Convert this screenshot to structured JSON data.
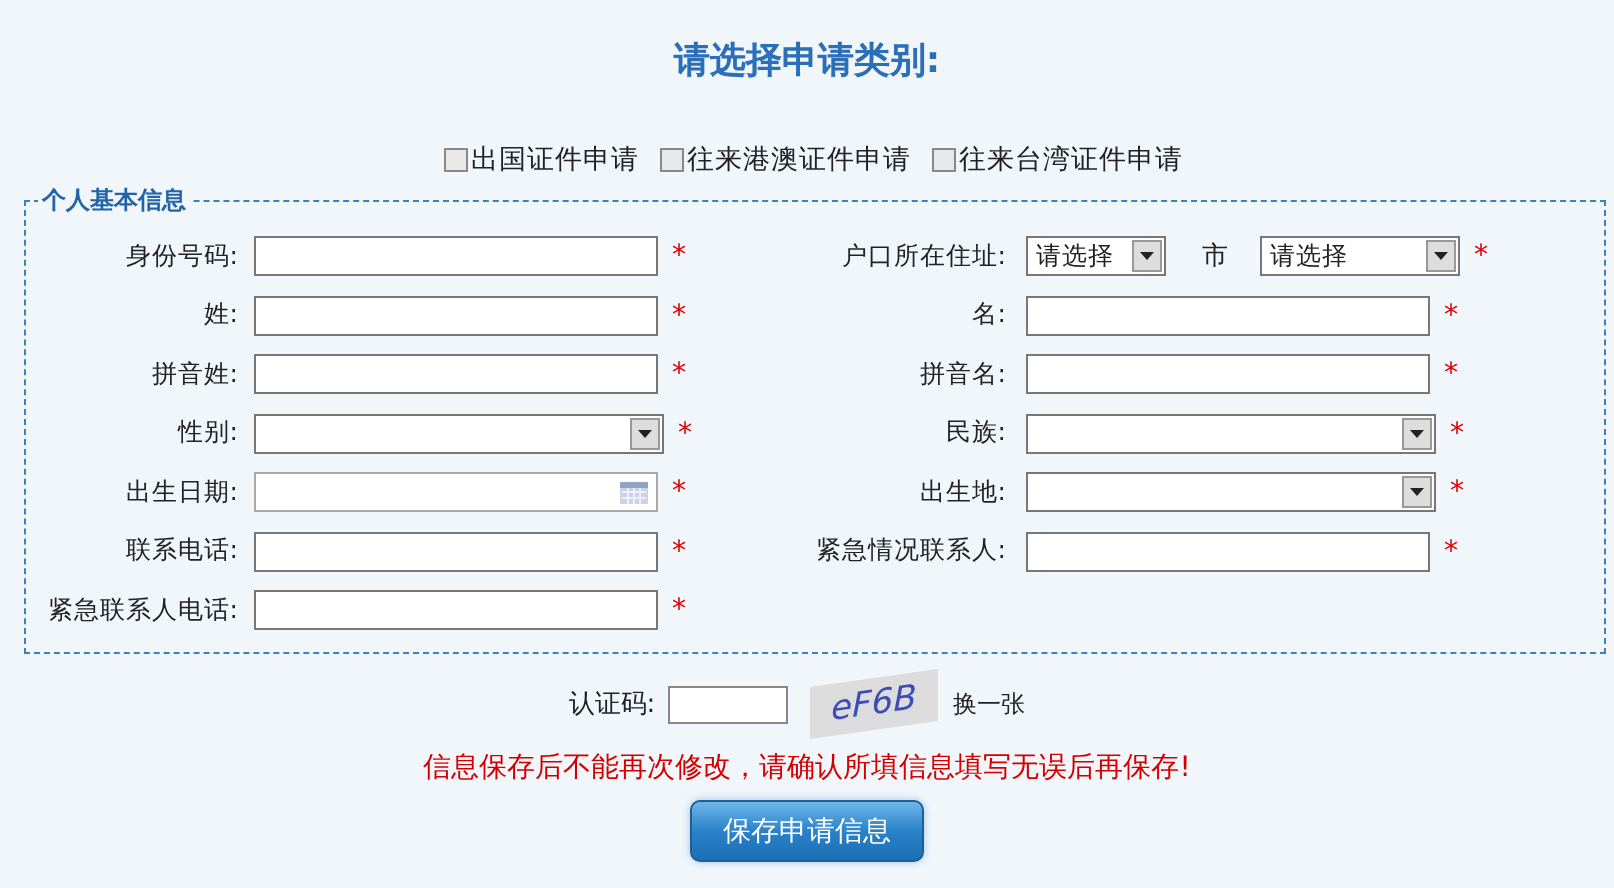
{
  "title": "请选择申请类别:",
  "categories": [
    {
      "label": "出国证件申请",
      "checked": false
    },
    {
      "label": "往来港澳证件申请",
      "checked": false
    },
    {
      "label": "往来台湾证件申请",
      "checked": false
    }
  ],
  "section": {
    "legend": "个人基本信息",
    "left_fields": [
      {
        "label": "身份号码:",
        "kind": "text",
        "required_mark": "*"
      },
      {
        "label": "姓:",
        "kind": "text",
        "required_mark": "*"
      },
      {
        "label": "拼音姓:",
        "kind": "text",
        "required_mark": "*"
      },
      {
        "label": "性别:",
        "kind": "select",
        "required_mark": "*"
      },
      {
        "label": "出生日期:",
        "kind": "date",
        "required_mark": "*"
      },
      {
        "label": "联系电话:",
        "kind": "text",
        "required_mark": "*"
      },
      {
        "label": "紧急联系人电话:",
        "kind": "text",
        "required_mark": "*"
      }
    ],
    "right_fields": [
      {
        "label": "户口所在住址:",
        "kind": "address",
        "province": "请选择",
        "city_label": "市",
        "city": "请选择",
        "required_mark": "*"
      },
      {
        "label": "名:",
        "kind": "text",
        "required_mark": "*"
      },
      {
        "label": "拼音名:",
        "kind": "text",
        "required_mark": "*"
      },
      {
        "label": "民族:",
        "kind": "select",
        "required_mark": "*"
      },
      {
        "label": "出生地:",
        "kind": "select",
        "required_mark": "*"
      },
      {
        "label": "紧急情况联系人:",
        "kind": "text",
        "required_mark": "*"
      }
    ]
  },
  "captcha": {
    "label": "认证码:",
    "code": "eF6B",
    "refresh": "换一张"
  },
  "warning": "信息保存后不能再次修改，请确认所填信息填写无误后再保存!",
  "save_button": "保存申请信息"
}
